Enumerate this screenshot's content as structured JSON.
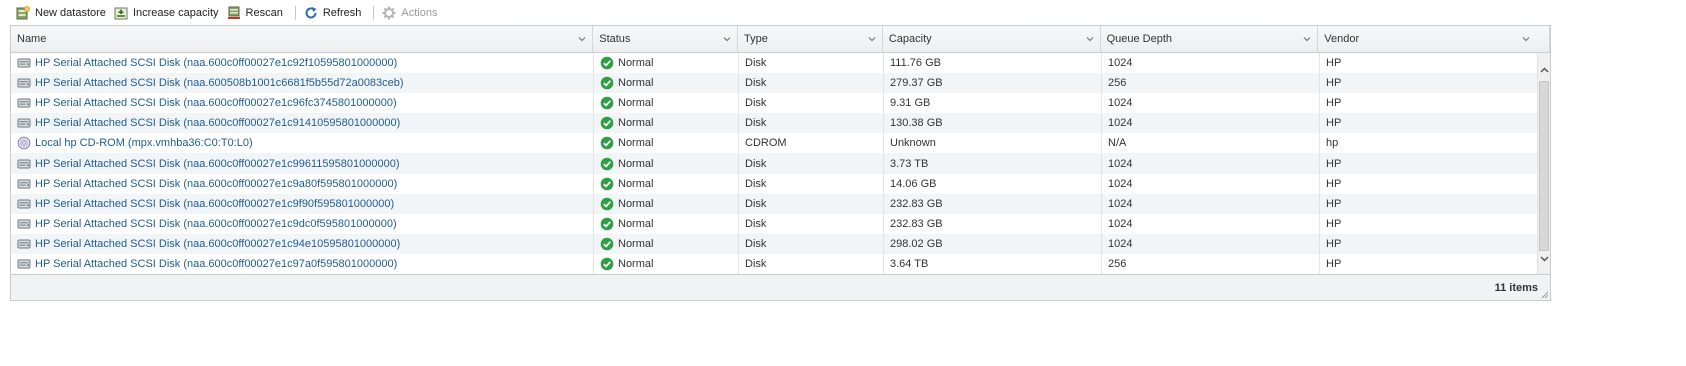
{
  "toolbar": {
    "new_datastore": "New datastore",
    "increase_capacity": "Increase capacity",
    "rescan": "Rescan",
    "refresh": "Refresh",
    "actions": "Actions"
  },
  "columns": [
    "Name",
    "Status",
    "Type",
    "Capacity",
    "Queue Depth",
    "Vendor"
  ],
  "rows": [
    {
      "name": "HP Serial Attached SCSI Disk (naa.600c0ff00027e1c92f10595801000000)",
      "icon": "disk-icon",
      "status": "Normal",
      "type": "Disk",
      "capacity": "111.76 GB",
      "queue_depth": "1024",
      "vendor": "HP"
    },
    {
      "name": "HP Serial Attached SCSI Disk (naa.600508b1001c6681f5b55d72a0083ceb)",
      "icon": "disk-icon",
      "status": "Normal",
      "type": "Disk",
      "capacity": "279.37 GB",
      "queue_depth": "256",
      "vendor": "HP"
    },
    {
      "name": "HP Serial Attached SCSI Disk (naa.600c0ff00027e1c96fc3745801000000)",
      "icon": "disk-icon",
      "status": "Normal",
      "type": "Disk",
      "capacity": "9.31 GB",
      "queue_depth": "1024",
      "vendor": "HP"
    },
    {
      "name": "HP Serial Attached SCSI Disk (naa.600c0ff00027e1c91410595801000000)",
      "icon": "disk-icon",
      "status": "Normal",
      "type": "Disk",
      "capacity": "130.38 GB",
      "queue_depth": "1024",
      "vendor": "HP"
    },
    {
      "name": "Local hp CD-ROM (mpx.vmhba36:C0:T0:L0)",
      "icon": "cdrom-icon",
      "status": "Normal",
      "type": "CDROM",
      "capacity": "Unknown",
      "queue_depth": "N/A",
      "vendor": "hp"
    },
    {
      "name": "HP Serial Attached SCSI Disk (naa.600c0ff00027e1c99611595801000000)",
      "icon": "disk-icon",
      "status": "Normal",
      "type": "Disk",
      "capacity": "3.73 TB",
      "queue_depth": "1024",
      "vendor": "HP"
    },
    {
      "name": "HP Serial Attached SCSI Disk (naa.600c0ff00027e1c9a80f595801000000)",
      "icon": "disk-icon",
      "status": "Normal",
      "type": "Disk",
      "capacity": "14.06 GB",
      "queue_depth": "1024",
      "vendor": "HP"
    },
    {
      "name": "HP Serial Attached SCSI Disk (naa.600c0ff00027e1c9f90f595801000000)",
      "icon": "disk-icon",
      "status": "Normal",
      "type": "Disk",
      "capacity": "232.83 GB",
      "queue_depth": "1024",
      "vendor": "HP"
    },
    {
      "name": "HP Serial Attached SCSI Disk (naa.600c0ff00027e1c9dc0f595801000000)",
      "icon": "disk-icon",
      "status": "Normal",
      "type": "Disk",
      "capacity": "232.83 GB",
      "queue_depth": "1024",
      "vendor": "HP"
    },
    {
      "name": "HP Serial Attached SCSI Disk (naa.600c0ff00027e1c94e10595801000000)",
      "icon": "disk-icon",
      "status": "Normal",
      "type": "Disk",
      "capacity": "298.02 GB",
      "queue_depth": "1024",
      "vendor": "HP"
    },
    {
      "name": "HP Serial Attached SCSI Disk (naa.600c0ff00027e1c97a0f595801000000)",
      "icon": "disk-icon",
      "status": "Normal",
      "type": "Disk",
      "capacity": "3.64 TB",
      "queue_depth": "256",
      "vendor": "HP"
    }
  ],
  "footer": {
    "items_count": "11 items"
  },
  "colors": {
    "link": "#1f5c94",
    "status_ok": "#2ea043",
    "row_alt": "#f2f5f8"
  }
}
